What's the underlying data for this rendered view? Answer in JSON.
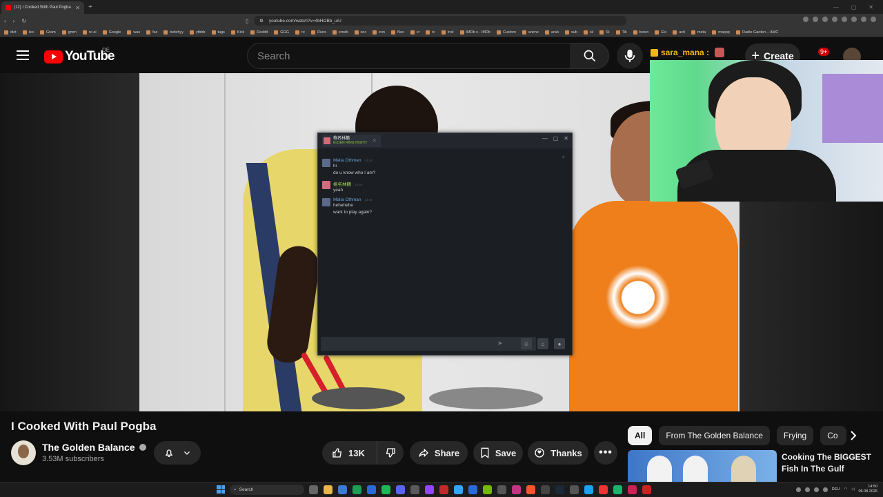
{
  "browser": {
    "tab_title": "(12) I Cooked With Paul Pogba",
    "url": "youtube.com/watch?v=4bHi2Bb_uiU",
    "bookmarks": [
      "dict",
      "leo",
      "Gram",
      "gmm",
      "re al",
      "Google",
      "was",
      "fac",
      "twitchyy",
      "ytbbb",
      "tags",
      "Kick",
      "Reddit",
      "GGG",
      "re",
      "Runs",
      "emeb",
      "soc",
      "zon",
      "Nex",
      "vr",
      "tc",
      "Inst",
      "IMDb s - IMDb",
      "Custom",
      "anime",
      "arab",
      "sub",
      "sk",
      "St",
      "Tik",
      "beten",
      "Ele",
      "acti",
      "meta",
      "mappp",
      "Radio Garden – AMC"
    ]
  },
  "header": {
    "logo_text": "YouTube",
    "country": "DE",
    "search_placeholder": "Search",
    "create_label": "Create",
    "notifications_badge": "9+"
  },
  "overlay": {
    "streamer_name": "sara_mana :"
  },
  "chat": {
    "tab_name": "檢名林鵝",
    "tab_game": "ELDEN RING NIGHT!",
    "messages": [
      {
        "name": "Malia Othman",
        "time": "14:48",
        "lines": [
          "hi",
          "do u know who I am?"
        ],
        "self": false
      },
      {
        "name": "檢名林鵝",
        "time": "14:49",
        "lines": [
          "yeah"
        ],
        "self": true
      },
      {
        "name": "Malia Othman",
        "time": "14:50",
        "lines": [
          "hehehehe",
          "want to play again?"
        ],
        "self": false
      }
    ],
    "input_value": ""
  },
  "video": {
    "title": "I Cooked With Paul Pogba",
    "channel": "The Golden Balance",
    "subscribers": "3.53M subscribers",
    "likes": "13K",
    "share_label": "Share",
    "save_label": "Save",
    "thanks_label": "Thanks"
  },
  "chips": [
    "All",
    "From The Golden Balance",
    "Frying",
    "Co"
  ],
  "recommendation": {
    "title": "Cooking The BIGGEST Fish In The Gulf"
  },
  "taskbar": {
    "search_label": "Search",
    "lang": "DEU",
    "time": "14:50",
    "date": "06.08.2026"
  }
}
